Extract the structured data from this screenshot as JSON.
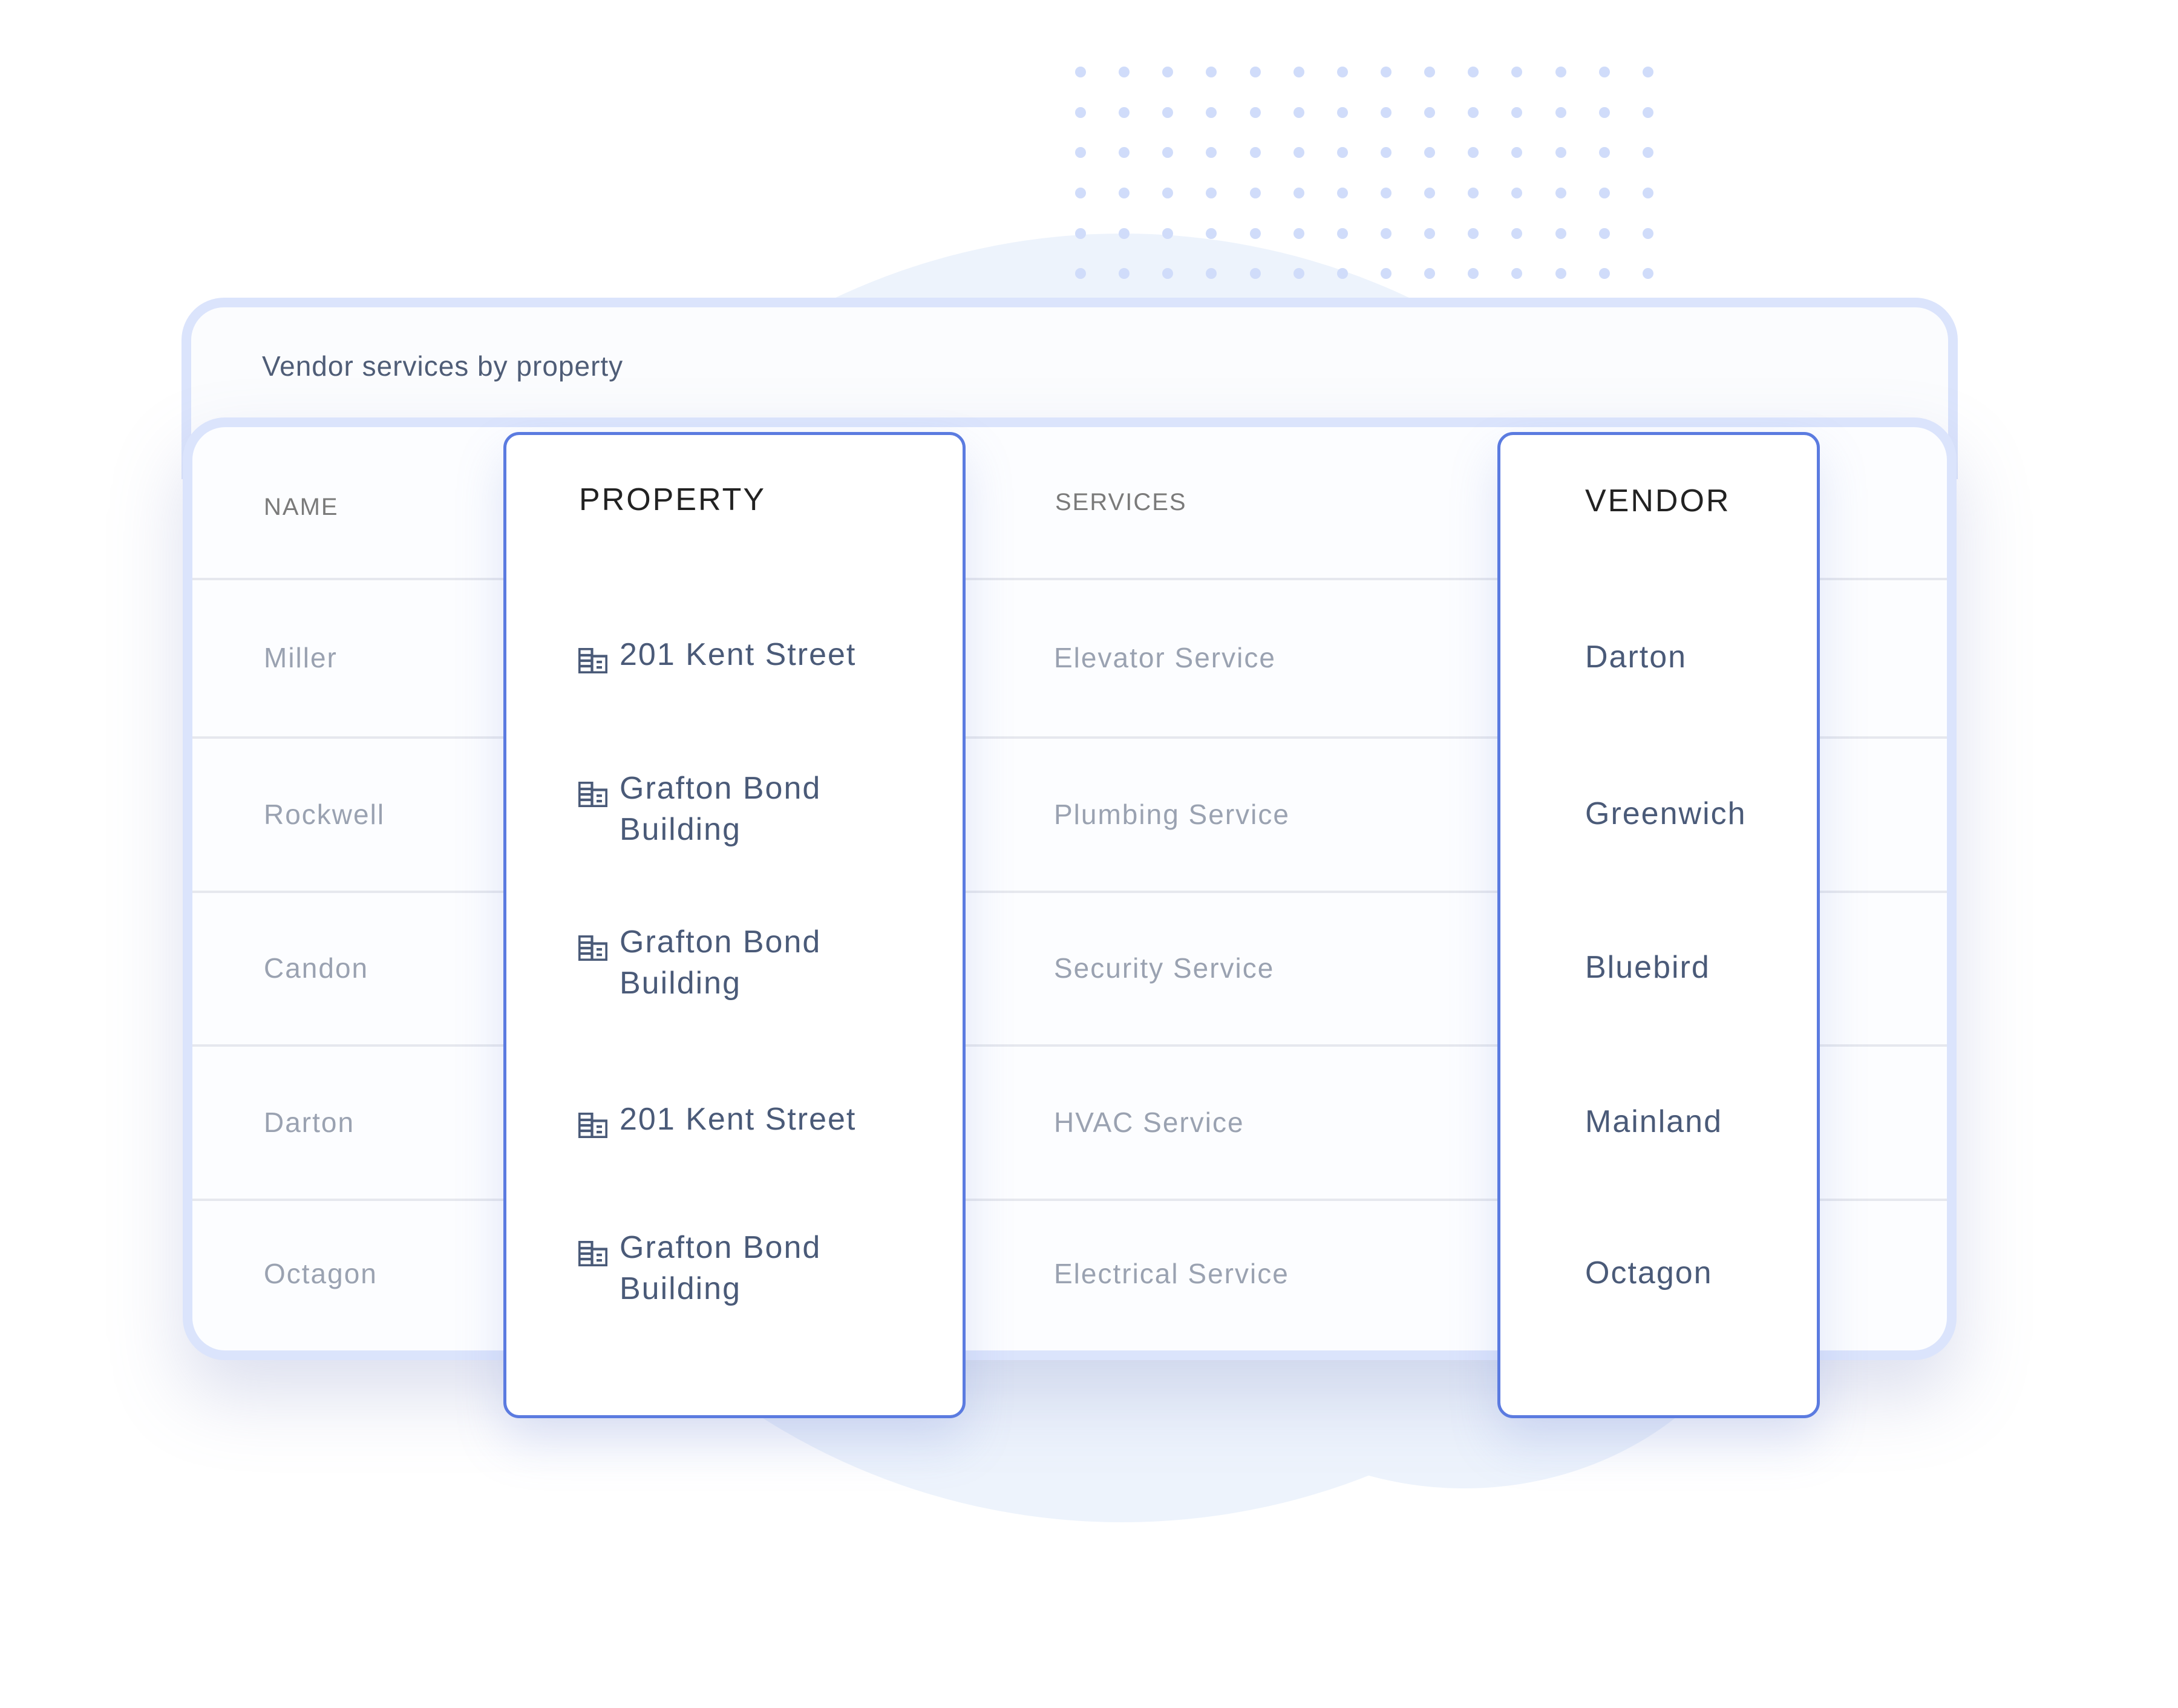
{
  "widget": {
    "title": "Vendor services by property"
  },
  "table": {
    "columns": {
      "name": "NAME",
      "property": "PROPERTY",
      "services": "SERVICES",
      "vendor": "VENDOR"
    },
    "highlighted_columns": [
      "PROPERTY",
      "VENDOR"
    ],
    "rows": [
      {
        "name": "Miller",
        "property": "201 Kent Street",
        "property_icon": "building-icon",
        "service": "Elevator Service",
        "vendor": "Darton"
      },
      {
        "name": "Rockwell",
        "property": "Grafton Bond Building",
        "property_icon": "building-icon",
        "service": "Plumbing Service",
        "vendor": "Greenwich"
      },
      {
        "name": "Candon",
        "property": "Grafton Bond Building",
        "property_icon": "building-icon",
        "service": "Security Service",
        "vendor": "Bluebird"
      },
      {
        "name": "Darton",
        "property": "201 Kent Street",
        "property_icon": "building-icon",
        "service": "HVAC Service",
        "vendor": "Mainland"
      },
      {
        "name": "Octagon",
        "property": "Grafton Bond Building",
        "property_icon": "building-icon",
        "service": "Electrical Service",
        "vendor": "Octagon"
      }
    ]
  },
  "colors": {
    "accent": "#5b7be0",
    "card_border": "#dbe4fc",
    "dot": "#d0dcfa",
    "blob": "#edf3fc",
    "text_primary": "#4a5a78",
    "text_muted": "#9aa2b1"
  }
}
